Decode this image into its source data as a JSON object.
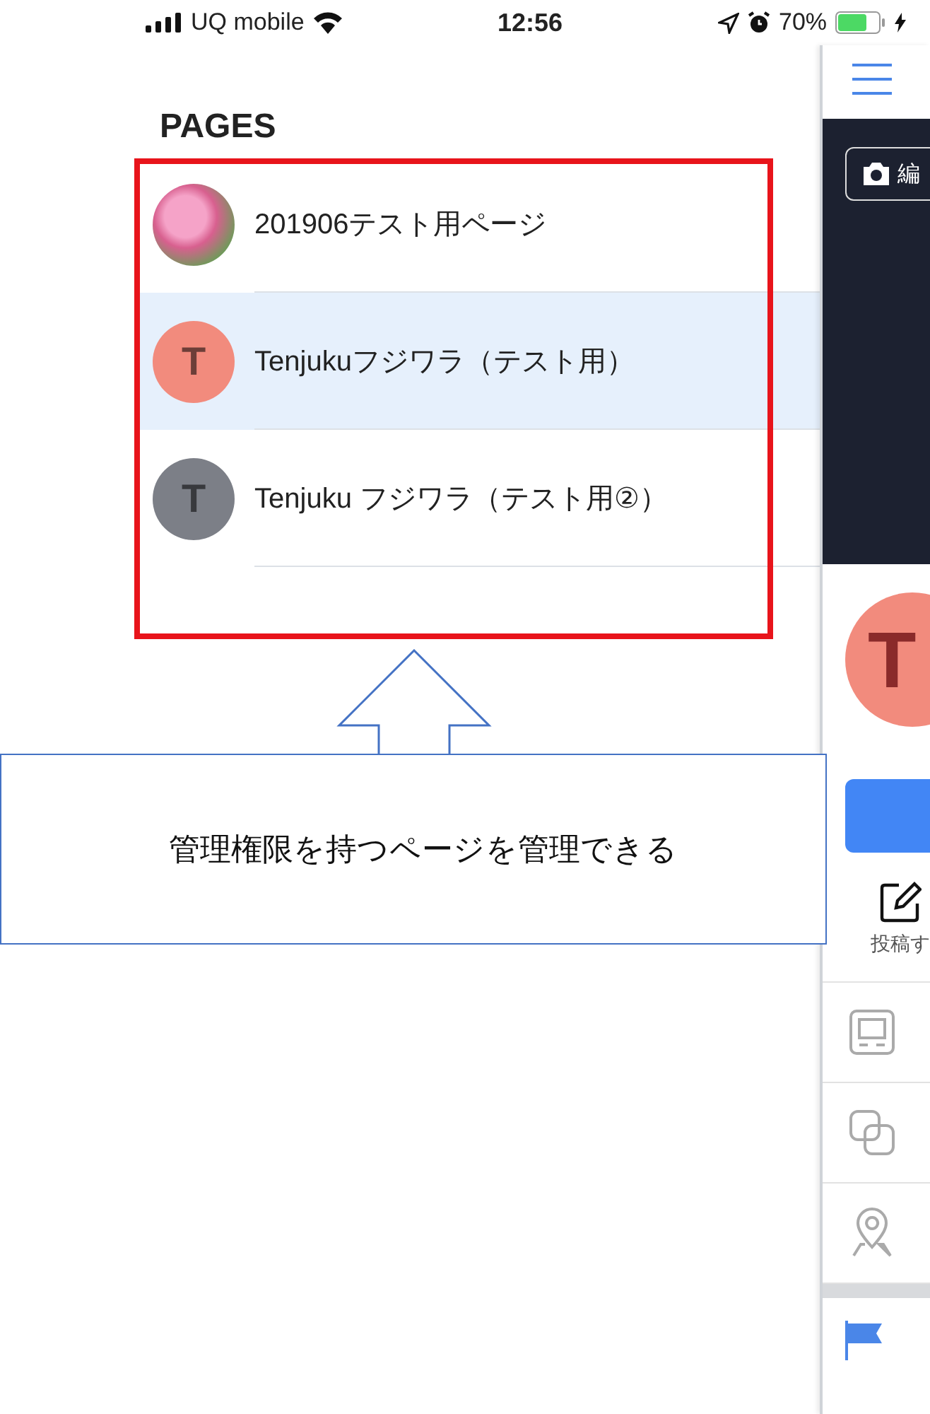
{
  "status_bar": {
    "carrier": "UQ mobile",
    "time": "12:56",
    "battery_percent": "70%"
  },
  "pages_panel": {
    "title": "PAGES",
    "pages": [
      {
        "kind": "photo",
        "name": "201906テスト用ページ",
        "selected": false
      },
      {
        "kind": "letter",
        "initial": "T",
        "color": "#f28b7d",
        "name": "Tenjukuフジワラ（テスト用）",
        "selected": true
      },
      {
        "kind": "letter",
        "initial": "T",
        "color": "#7c7f87",
        "name": "Tenjuku フジワラ（テスト用②）",
        "selected": false
      }
    ]
  },
  "side_page": {
    "edit_button": "編",
    "avatar_initial": "T",
    "post_tab": "投稿す"
  },
  "annotation": {
    "callout": "管理権限を持つページを管理できる"
  }
}
